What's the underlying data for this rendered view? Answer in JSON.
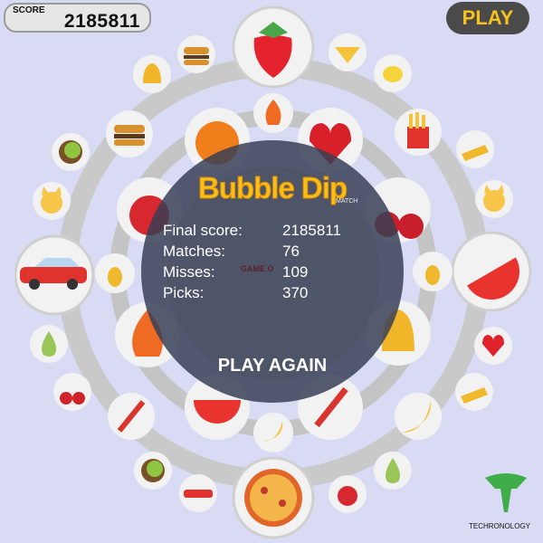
{
  "hud": {
    "score_label": "SCORE",
    "score_value": "2185811",
    "play_label": "PLAY"
  },
  "game_over": {
    "title": "Bubble Dip",
    "subtitle": "MATCH",
    "background_text": "GAME O",
    "stats": [
      {
        "label": "Final score:",
        "value": "2185811"
      },
      {
        "label": "Matches:",
        "value": "76"
      },
      {
        "label": "Misses:",
        "value": "109"
      },
      {
        "label": "Picks:",
        "value": "370"
      }
    ],
    "play_again_label": "PLAY AGAIN"
  },
  "board_items": [
    "strawberry",
    "burger",
    "diamond",
    "bell",
    "lemon",
    "orange",
    "fire",
    "heart",
    "kiwi",
    "fries",
    "gold-bars",
    "cat",
    "apple",
    "cherries",
    "car",
    "pineapple",
    "watermelon",
    "pear",
    "banana",
    "candy-cane",
    "pizza"
  ],
  "brand": {
    "name": "TECHRONOLOGY",
    "color": "#3fae49"
  },
  "colors": {
    "background": "#d9dbf5",
    "accent": "#f7c21b",
    "overlay": "#373e55"
  }
}
